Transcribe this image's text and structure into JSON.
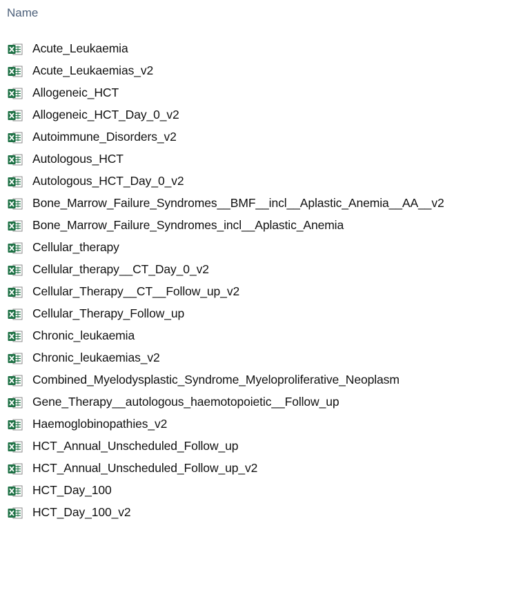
{
  "header": {
    "column_name": "Name"
  },
  "files": [
    {
      "name": "Acute_Leukaemia",
      "icon": "excel-file-icon"
    },
    {
      "name": "Acute_Leukaemias_v2",
      "icon": "excel-file-icon"
    },
    {
      "name": "Allogeneic_HCT",
      "icon": "excel-file-icon"
    },
    {
      "name": "Allogeneic_HCT_Day_0_v2",
      "icon": "excel-file-icon"
    },
    {
      "name": "Autoimmune_Disorders_v2",
      "icon": "excel-file-icon"
    },
    {
      "name": "Autologous_HCT",
      "icon": "excel-file-icon"
    },
    {
      "name": "Autologous_HCT_Day_0_v2",
      "icon": "excel-file-icon"
    },
    {
      "name": "Bone_Marrow_Failure_Syndromes__BMF__incl__Aplastic_Anemia__AA__v2",
      "icon": "excel-file-icon"
    },
    {
      "name": "Bone_Marrow_Failure_Syndromes_incl__Aplastic_Anemia",
      "icon": "excel-file-icon"
    },
    {
      "name": "Cellular_therapy",
      "icon": "excel-file-icon"
    },
    {
      "name": "Cellular_therapy__CT_Day_0_v2",
      "icon": "excel-file-icon"
    },
    {
      "name": "Cellular_Therapy__CT__Follow_up_v2",
      "icon": "excel-file-icon"
    },
    {
      "name": "Cellular_Therapy_Follow_up",
      "icon": "excel-file-icon"
    },
    {
      "name": "Chronic_leukaemia",
      "icon": "excel-file-icon"
    },
    {
      "name": "Chronic_leukaemias_v2",
      "icon": "excel-file-icon"
    },
    {
      "name": "Combined_Myelodysplastic_Syndrome_Myeloproliferative_Neoplasm",
      "icon": "excel-file-icon"
    },
    {
      "name": "Gene_Therapy__autologous_haemotopoietic__Follow_up",
      "icon": "excel-file-icon"
    },
    {
      "name": "Haemoglobinopathies_v2",
      "icon": "excel-file-icon"
    },
    {
      "name": "HCT_Annual_Unscheduled_Follow_up",
      "icon": "excel-file-icon"
    },
    {
      "name": "HCT_Annual_Unscheduled_Follow_up_v2",
      "icon": "excel-file-icon"
    },
    {
      "name": "HCT_Day_100",
      "icon": "excel-file-icon"
    },
    {
      "name": "HCT_Day_100_v2",
      "icon": "excel-file-icon"
    }
  ],
  "colors": {
    "excel_green": "#1e7145",
    "header_text": "#4c607a"
  }
}
